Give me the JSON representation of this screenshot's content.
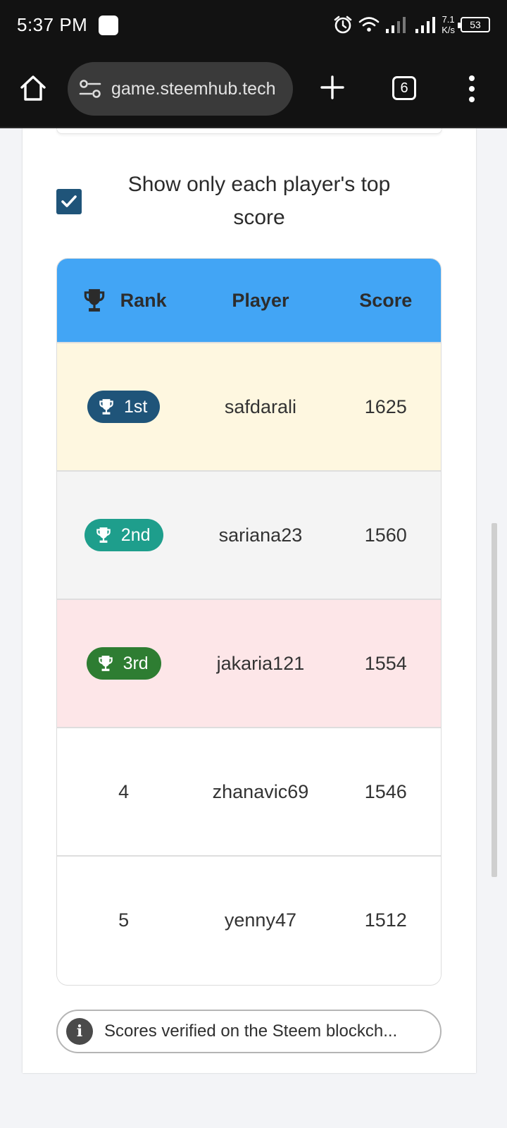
{
  "status_bar": {
    "time": "5:37 PM",
    "net_speed_value": "7.1",
    "net_speed_unit": "K/s",
    "battery": "53"
  },
  "browser": {
    "url": "game.steemhub.tech",
    "tab_count": "6"
  },
  "filter": {
    "checked": true,
    "label": "Show only each player's top score"
  },
  "leaderboard": {
    "headers": {
      "rank": "Rank",
      "player": "Player",
      "score": "Score"
    },
    "rows": [
      {
        "rank": "1st",
        "player": "safdarali",
        "score": "1625"
      },
      {
        "rank": "2nd",
        "player": "sariana23",
        "score": "1560"
      },
      {
        "rank": "3rd",
        "player": "jakaria121",
        "score": "1554"
      },
      {
        "rank": "4",
        "player": "zhanavic69",
        "score": "1546"
      },
      {
        "rank": "5",
        "player": "yenny47",
        "score": "1512"
      }
    ]
  },
  "info": {
    "icon": "info-icon",
    "text": "Scores verified on the Steem blockch..."
  },
  "colors": {
    "header_bg": "#42a5f5",
    "gold_row": "#fef7e0",
    "silver_row": "#f4f4f4",
    "bronze_row": "#fde6e8",
    "badge_1st": "#1f5479",
    "badge_2nd": "#1e9e8c",
    "badge_3rd": "#2e7d32"
  }
}
